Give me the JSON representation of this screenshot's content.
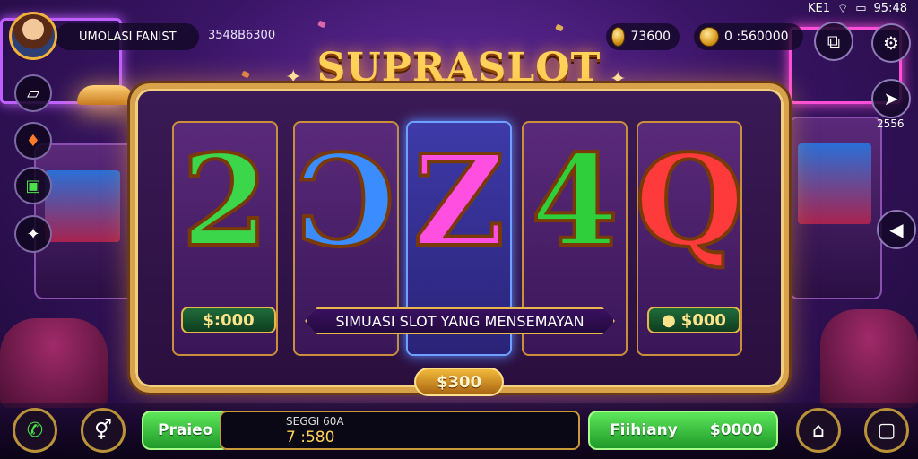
{
  "status_bar": {
    "signal": "KE1",
    "wifi": "wifi-icon",
    "battery": "battery-icon",
    "time": "95:48"
  },
  "player": {
    "name": "UMOLASI FANIST",
    "id": "3548B6300"
  },
  "currencies": [
    {
      "icon": "coin-icon",
      "value": "73600"
    },
    {
      "icon": "coin-icon",
      "value": "0 :560000"
    }
  ],
  "title": "SUPRASLOT",
  "reels": [
    {
      "symbol": "2",
      "color": "#3bd64a"
    },
    {
      "symbol": "Ɔ",
      "color": "#3a8cff"
    },
    {
      "symbol": "Z",
      "color": "#ff4fe0"
    },
    {
      "symbol": "4",
      "color": "#2ecf3a"
    },
    {
      "symbol": "Q",
      "color": "#ff3a3a"
    }
  ],
  "win_left": "$:000",
  "win_right": "$000",
  "banner": "SIMUASI SLOT YANG MENSEMAYAN",
  "bet": "$300",
  "right_side": {
    "share_count": "2556"
  },
  "bottom": {
    "left_label": "Praieo",
    "balance_label": "SEGGI 60A",
    "balance_value": "7 :580",
    "right_label": "Fiihiany",
    "right_value": "$0000"
  },
  "colors": {
    "gold": "#d8a24a",
    "green": "#3fbf3a",
    "purple": "#3a1566"
  }
}
